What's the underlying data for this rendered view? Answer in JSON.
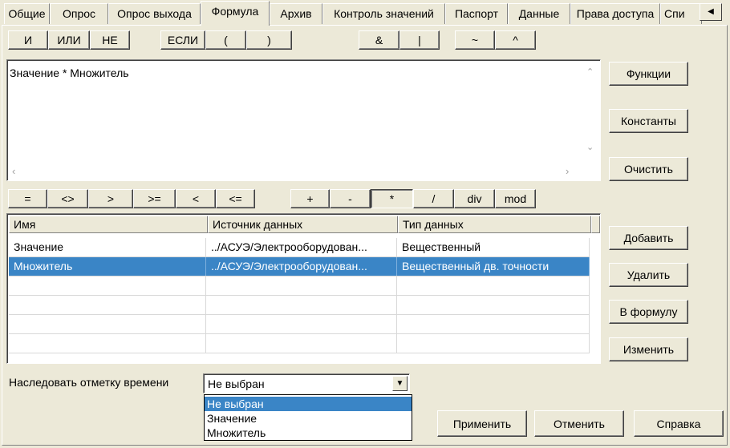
{
  "tabs": [
    "Общие",
    "Опрос",
    "Опрос выхода",
    "Формула",
    "Архив",
    "Контроль значений",
    "Паспорт",
    "Данные",
    "Права доступа",
    "Спи"
  ],
  "active_tab": "Формула",
  "tab_scroll_icon": "left-arrow-icon",
  "logic_buttons": [
    "И",
    "ИЛИ",
    "НЕ",
    "ЕСЛИ",
    "(",
    ")",
    "&",
    "|",
    "~",
    "^"
  ],
  "formula_text": "Значение * Множитель",
  "side_buttons": {
    "functions": "Функции",
    "constants": "Константы",
    "clear": "Очистить"
  },
  "operator_buttons": [
    "=",
    "<>",
    ">",
    ">=",
    "<",
    "<=",
    "+",
    "-",
    "*",
    "/",
    "div",
    "mod"
  ],
  "pressed_operator": "*",
  "table": {
    "columns": [
      "Имя",
      "Источник данных",
      "Тип данных"
    ],
    "rows": [
      [
        "Значение",
        "../АСУЭ/Электрооборудован...",
        "Вещественный"
      ],
      [
        "Множитель",
        "../АСУЭ/Электрооборудован...",
        "Вещественный дв. точности"
      ]
    ],
    "selected_row": 1
  },
  "var_buttons": {
    "add": "Добавить",
    "delete": "Удалить",
    "to_formula": "В формулу",
    "edit": "Изменить"
  },
  "inherit": {
    "label": "Наследовать отметку времени",
    "value": "Не выбран",
    "options": [
      "Не выбран",
      "Значение",
      "Множитель"
    ],
    "selected_option": 0
  },
  "footer": {
    "apply": "Применить",
    "cancel": "Отменить",
    "help": "Справка"
  },
  "colors": {
    "background": "#ece9d8",
    "selection": "#3a85c6"
  }
}
